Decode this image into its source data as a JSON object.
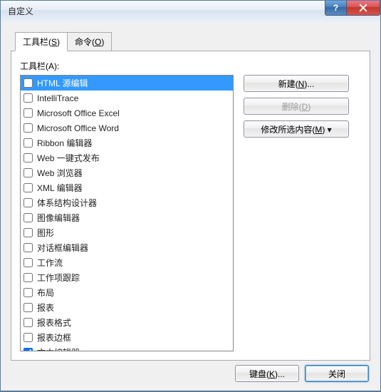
{
  "title": "自定义",
  "tabs": [
    {
      "label": "工具栏",
      "accessKey": "S",
      "active": true
    },
    {
      "label": "命令",
      "accessKey": "O",
      "active": false
    }
  ],
  "panel": {
    "listLabel": "工具栏",
    "listAccessKey": "A"
  },
  "toolbars": [
    {
      "label": "HTML 源编辑",
      "checked": false,
      "selected": true
    },
    {
      "label": "IntelliTrace",
      "checked": false,
      "selected": false
    },
    {
      "label": "Microsoft Office Excel",
      "checked": false,
      "selected": false
    },
    {
      "label": "Microsoft Office Word",
      "checked": false,
      "selected": false
    },
    {
      "label": "Ribbon 编辑器",
      "checked": false,
      "selected": false
    },
    {
      "label": "Web 一键式发布",
      "checked": false,
      "selected": false
    },
    {
      "label": "Web 浏览器",
      "checked": false,
      "selected": false
    },
    {
      "label": "XML 编辑器",
      "checked": false,
      "selected": false
    },
    {
      "label": "体系结构设计器",
      "checked": false,
      "selected": false
    },
    {
      "label": "图像编辑器",
      "checked": false,
      "selected": false
    },
    {
      "label": "图形",
      "checked": false,
      "selected": false
    },
    {
      "label": "对话框编辑器",
      "checked": false,
      "selected": false
    },
    {
      "label": "工作流",
      "checked": false,
      "selected": false
    },
    {
      "label": "工作项跟踪",
      "checked": false,
      "selected": false
    },
    {
      "label": "布局",
      "checked": false,
      "selected": false
    },
    {
      "label": "报表",
      "checked": false,
      "selected": false
    },
    {
      "label": "报表格式",
      "checked": false,
      "selected": false
    },
    {
      "label": "报表边框",
      "checked": false,
      "selected": false
    },
    {
      "label": "文本编辑器",
      "checked": true,
      "selected": false
    }
  ],
  "buttons": {
    "new": {
      "label": "新建",
      "accessKey": "N",
      "suffix": "...",
      "disabled": false
    },
    "delete": {
      "label": "删除",
      "accessKey": "D",
      "suffix": "",
      "disabled": true
    },
    "modify": {
      "label": "修改所选内容",
      "accessKey": "M",
      "suffix": " ▾",
      "disabled": false
    }
  },
  "footer": {
    "keyboard": {
      "label": "键盘",
      "accessKey": "K",
      "suffix": "..."
    },
    "close": {
      "label": "关闭"
    }
  }
}
